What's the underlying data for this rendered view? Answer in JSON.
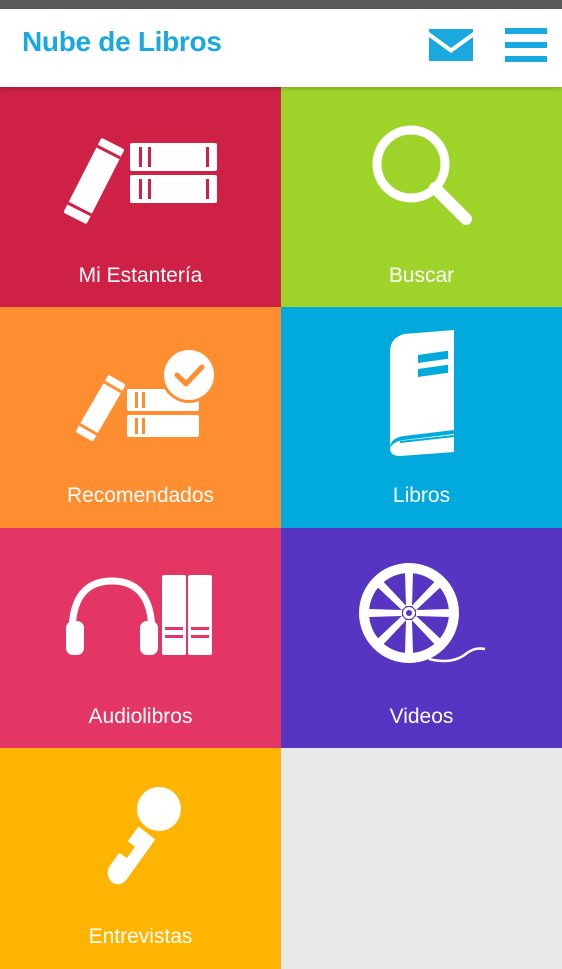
{
  "app": {
    "title": "Nube de Libros",
    "accent_color": "#1aa9df",
    "header_icons": [
      "mail-icon",
      "menu-icon"
    ]
  },
  "tiles": [
    {
      "id": "mi-estanteria",
      "label": "Mi Estantería",
      "icon": "bookshelf-icon",
      "color": "#cf2146"
    },
    {
      "id": "buscar",
      "label": "Buscar",
      "icon": "search-icon",
      "color": "#9ed42a"
    },
    {
      "id": "recomendados",
      "label": "Recomendados",
      "icon": "recommended-books-icon",
      "color": "#fe8e2f"
    },
    {
      "id": "libros",
      "label": "Libros",
      "icon": "book-icon",
      "color": "#00aadd"
    },
    {
      "id": "audiolibros",
      "label": "Audiolibros",
      "icon": "headphones-books-icon",
      "color": "#e33664"
    },
    {
      "id": "videos",
      "label": "Videos",
      "icon": "film-reel-icon",
      "color": "#5535c1"
    },
    {
      "id": "entrevistas",
      "label": "Entrevistas",
      "icon": "microphone-icon",
      "color": "#ffb401"
    }
  ]
}
